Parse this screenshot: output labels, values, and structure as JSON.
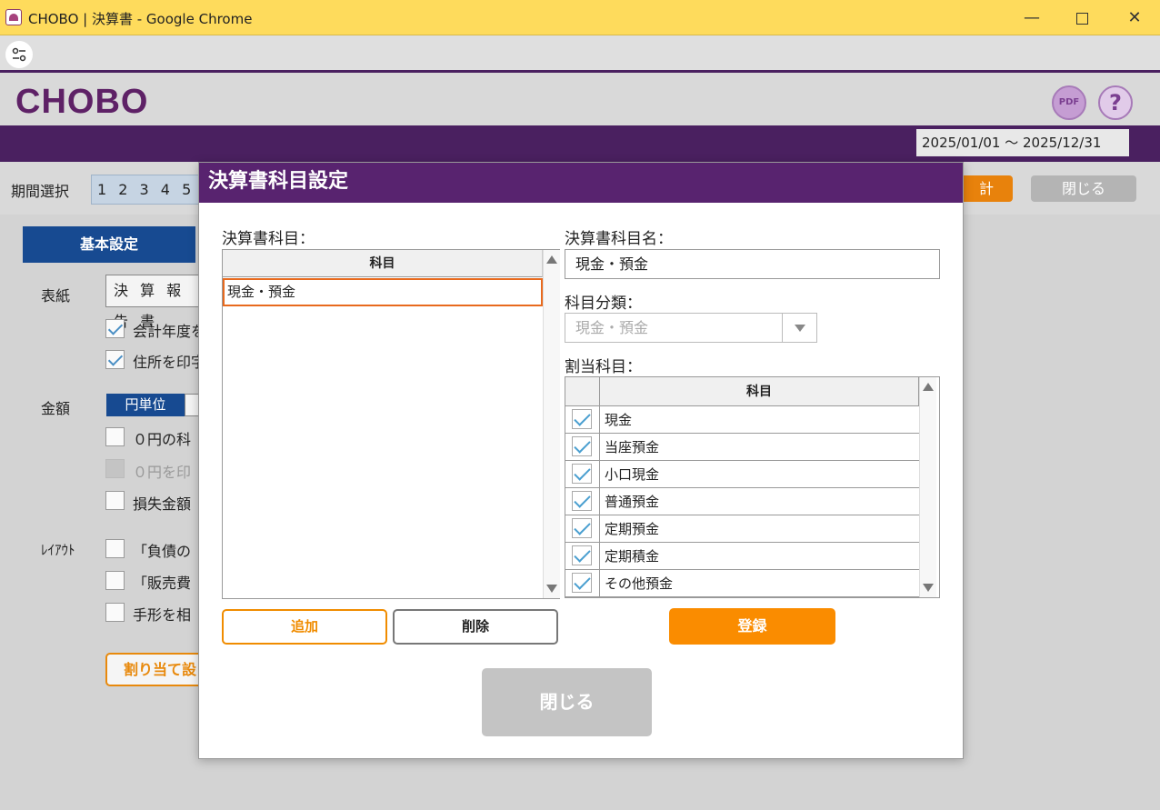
{
  "window": {
    "title": "CHOBO | 決算書 - Google Chrome",
    "minimize": "—",
    "close": "✕"
  },
  "app": {
    "logo": "CHOBO",
    "pdf_icon": "PDF",
    "help_icon": "?",
    "period": "2025/01/01 〜 2025/12/31"
  },
  "background": {
    "period_label": "期間選択",
    "period_numbers": "1 2 3 4 5",
    "calc_button": "計",
    "close_button": "閉じる",
    "tab_basic": "基本設定",
    "cover_label": "表紙",
    "cover_value": "決 算 報 告 書",
    "cb_fiscal_year": "会計年度を",
    "cb_address": "住所を印字",
    "amount_label": "金額",
    "unit_yen": "円単位",
    "cb_zero_items": "０円の科",
    "cb_zero_print": "０円を印",
    "cb_loss": "損失金額",
    "layout_label": "ﾚｲｱｳﾄ",
    "cb_liabilities": "「負債の",
    "cb_sales": "「販売費",
    "cb_notes": "手形を相",
    "assign_button": "割り当て設"
  },
  "modal": {
    "title": "決算書科目設定",
    "items_label": "決算書科目：",
    "items_header": "科目",
    "items": [
      "現金・預金"
    ],
    "name_label": "決算書科目名：",
    "name_value": "現金・預金",
    "category_label": "科目分類：",
    "category_value": "現金・預金",
    "assigned_label": "割当科目：",
    "assigned_header": "科目",
    "assigned": [
      {
        "name": "現金",
        "checked": true
      },
      {
        "name": "当座預金",
        "checked": true
      },
      {
        "name": "小口現金",
        "checked": true
      },
      {
        "name": "普通預金",
        "checked": true
      },
      {
        "name": "定期預金",
        "checked": true
      },
      {
        "name": "定期積金",
        "checked": true
      },
      {
        "name": "その他預金",
        "checked": true
      }
    ],
    "add_button": "追加",
    "delete_button": "削除",
    "register_button": "登録",
    "close_button": "閉じる"
  },
  "colors": {
    "titlebar": "#fedb5c",
    "brand_purple": "#58236f",
    "accent_orange": "#fa8c00",
    "tab_blue": "#174a91"
  }
}
